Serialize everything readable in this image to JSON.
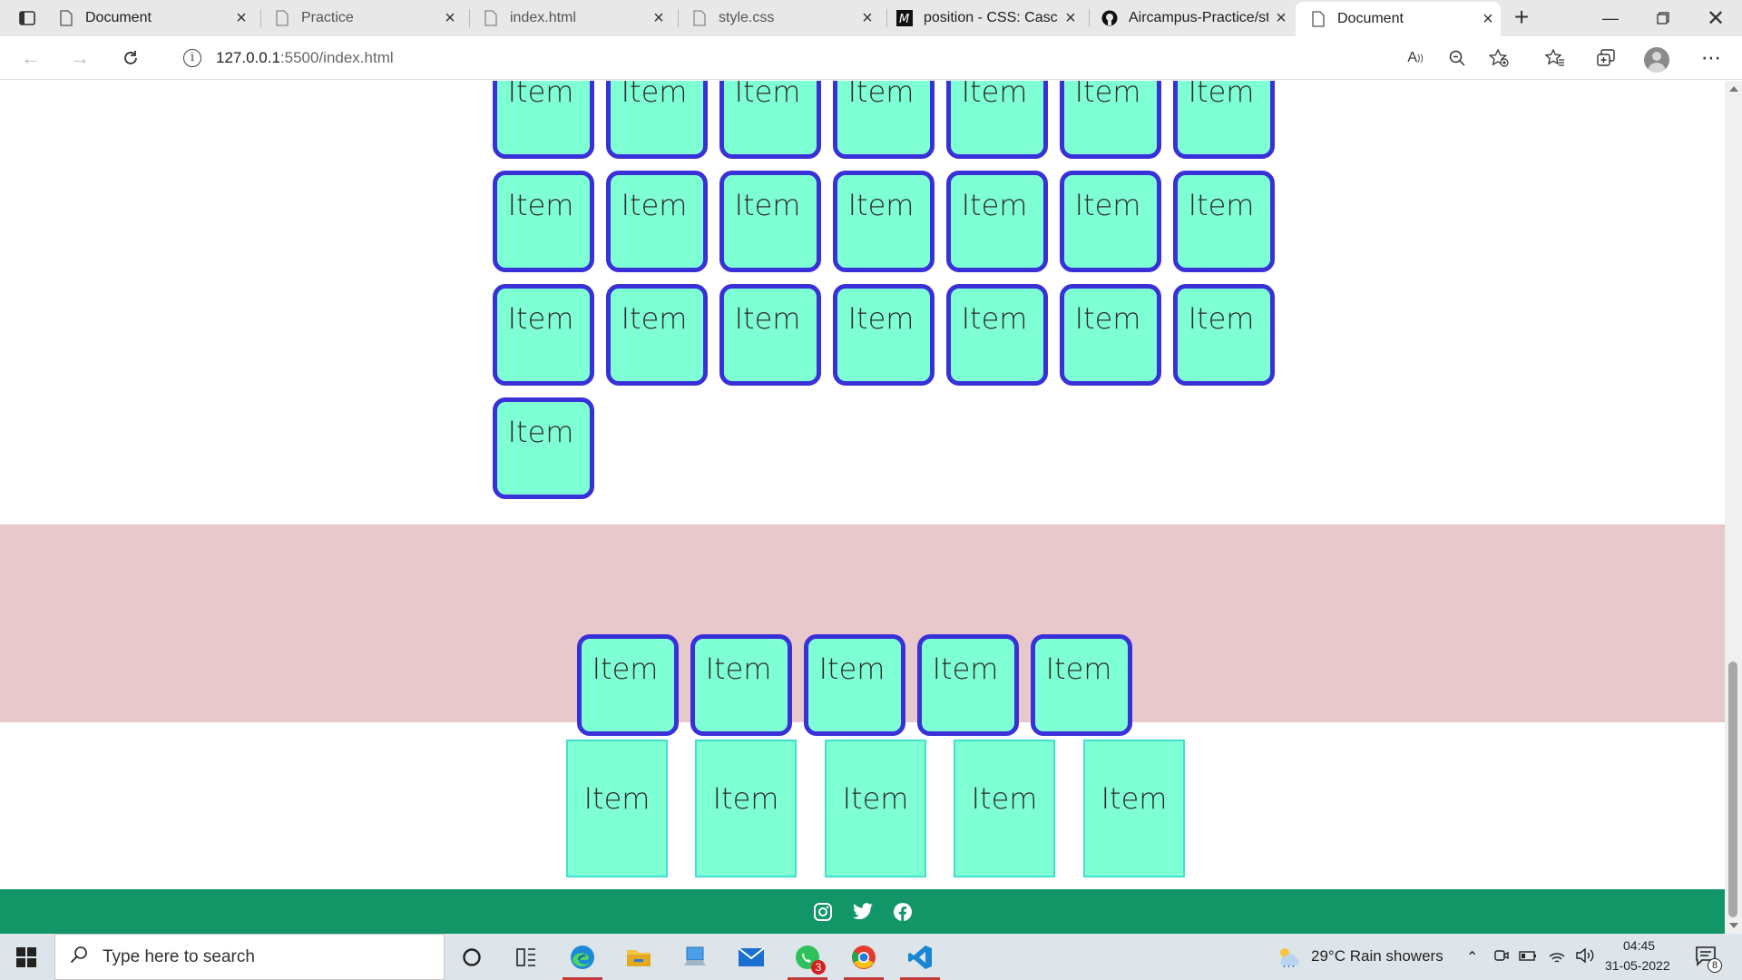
{
  "browser": {
    "tabs": [
      {
        "title": "Document",
        "icon": "page-icon"
      },
      {
        "title": "Practice",
        "icon": "page-icon"
      },
      {
        "title": "index.html",
        "icon": "page-icon"
      },
      {
        "title": "style.css",
        "icon": "page-icon"
      },
      {
        "title": "position - CSS: Cascad",
        "icon": "mdn-icon"
      },
      {
        "title": "Aircampus-Practice/st",
        "icon": "github-icon"
      },
      {
        "title": "Document",
        "icon": "page-icon",
        "active": true
      }
    ],
    "address": {
      "host": "127.0.0.1",
      "rest": ":5500/index.html"
    }
  },
  "page": {
    "item_label": "Item",
    "grid_rows": [
      7,
      7,
      7,
      1
    ],
    "pink_row_count": 5,
    "flat_row_count": 5,
    "footer_icons": [
      "instagram-icon",
      "twitter-icon",
      "facebook-icon"
    ],
    "colors": {
      "item_bg": "#7fffd4",
      "item_border": "#3a30d8",
      "pink_bg": "#e8c8cb",
      "footer_bg": "#129668"
    }
  },
  "taskbar": {
    "search_placeholder": "Type here to search",
    "weather": "29°C  Rain showers",
    "time": "04:45",
    "date": "31-05-2022",
    "whatsapp_badge": "3",
    "notifications_badge": "8"
  }
}
